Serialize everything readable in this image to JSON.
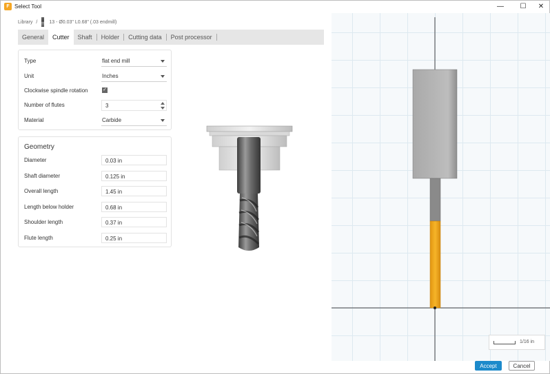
{
  "window": {
    "title": "Select Tool",
    "minimize": "—",
    "maximize": "☐",
    "close": "✕",
    "app_icon": "F"
  },
  "breadcrumb": {
    "root": "Library",
    "separator": "/",
    "tool_name": "13 - Ø0.03\" L0.68\" (.03 endmill)"
  },
  "tabs": [
    {
      "label": "General",
      "active": false
    },
    {
      "label": "Cutter",
      "active": true
    },
    {
      "label": "Shaft",
      "active": false
    },
    {
      "label": "Holder",
      "active": false
    },
    {
      "label": "Cutting data",
      "active": false
    },
    {
      "label": "Post processor",
      "active": false
    }
  ],
  "cutter": {
    "type_label": "Type",
    "type_value": "flat end mill",
    "unit_label": "Unit",
    "unit_value": "Inches",
    "spindle_label": "Clockwise spindle rotation",
    "spindle_checked": true,
    "flutes_label": "Number of flutes",
    "flutes_value": "3",
    "material_label": "Material",
    "material_value": "Carbide"
  },
  "geometry": {
    "title": "Geometry",
    "fields": [
      {
        "label": "Diameter",
        "value": "0.03 in"
      },
      {
        "label": "Shaft diameter",
        "value": "0.125 in"
      },
      {
        "label": "Overall length",
        "value": "1.45 in"
      },
      {
        "label": "Length below holder",
        "value": "0.68 in"
      },
      {
        "label": "Shoulder length",
        "value": "0.37 in"
      },
      {
        "label": "Flute length",
        "value": "0.25 in"
      }
    ]
  },
  "viewport": {
    "scale_label": "1/16 in",
    "flute_color": "#f0a81e",
    "shank_color": "#8a8a8a",
    "holder_color": "#b5b5b5"
  },
  "buttons": {
    "accept": "Accept",
    "cancel": "Cancel"
  }
}
